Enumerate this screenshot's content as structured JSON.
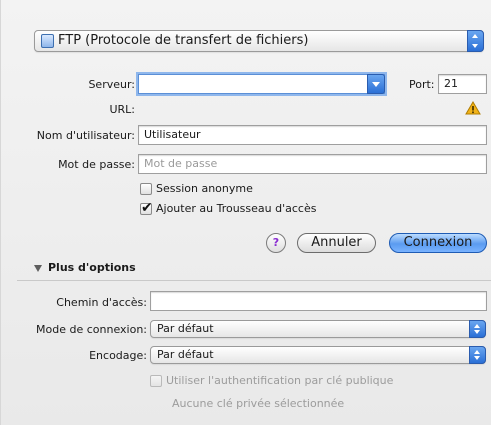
{
  "protocol": {
    "selected": "FTP (Protocole de transfert de fichiers)"
  },
  "form": {
    "server_label": "Serveur:",
    "server_value": "",
    "port_label": "Port:",
    "port_value": "21",
    "url_label": "URL:",
    "username_label": "Nom d'utilisateur:",
    "username_value": "Utilisateur",
    "password_label": "Mot de passe:",
    "password_placeholder": "Mot de passe",
    "anonymous_label": "Session anonyme",
    "anonymous_checked": false,
    "keychain_label": "Ajouter au Trousseau d'accès",
    "keychain_checked": true
  },
  "buttons": {
    "help": "?",
    "cancel": "Annuler",
    "connect": "Connexion"
  },
  "options": {
    "title": "Plus d'options",
    "path_label": "Chemin d'accès:",
    "path_value": "",
    "mode_label": "Mode de connexion:",
    "mode_value": "Par défaut",
    "encoding_label": "Encodage:",
    "encoding_value": "Par défaut",
    "pubkey_label": "Utiliser l'authentification par clé publique",
    "pubkey_checked": false,
    "no_key_text": "Aucune clé privée sélectionnée"
  },
  "icons": {
    "warning": "warning-triangle-icon",
    "protocol": "ftp-icon",
    "disclosure": "disclosure-triangle-icon"
  },
  "colors": {
    "accent": "#2a6fd6",
    "help_glyph": "#8a2bd1",
    "warning": "#f2b318"
  }
}
